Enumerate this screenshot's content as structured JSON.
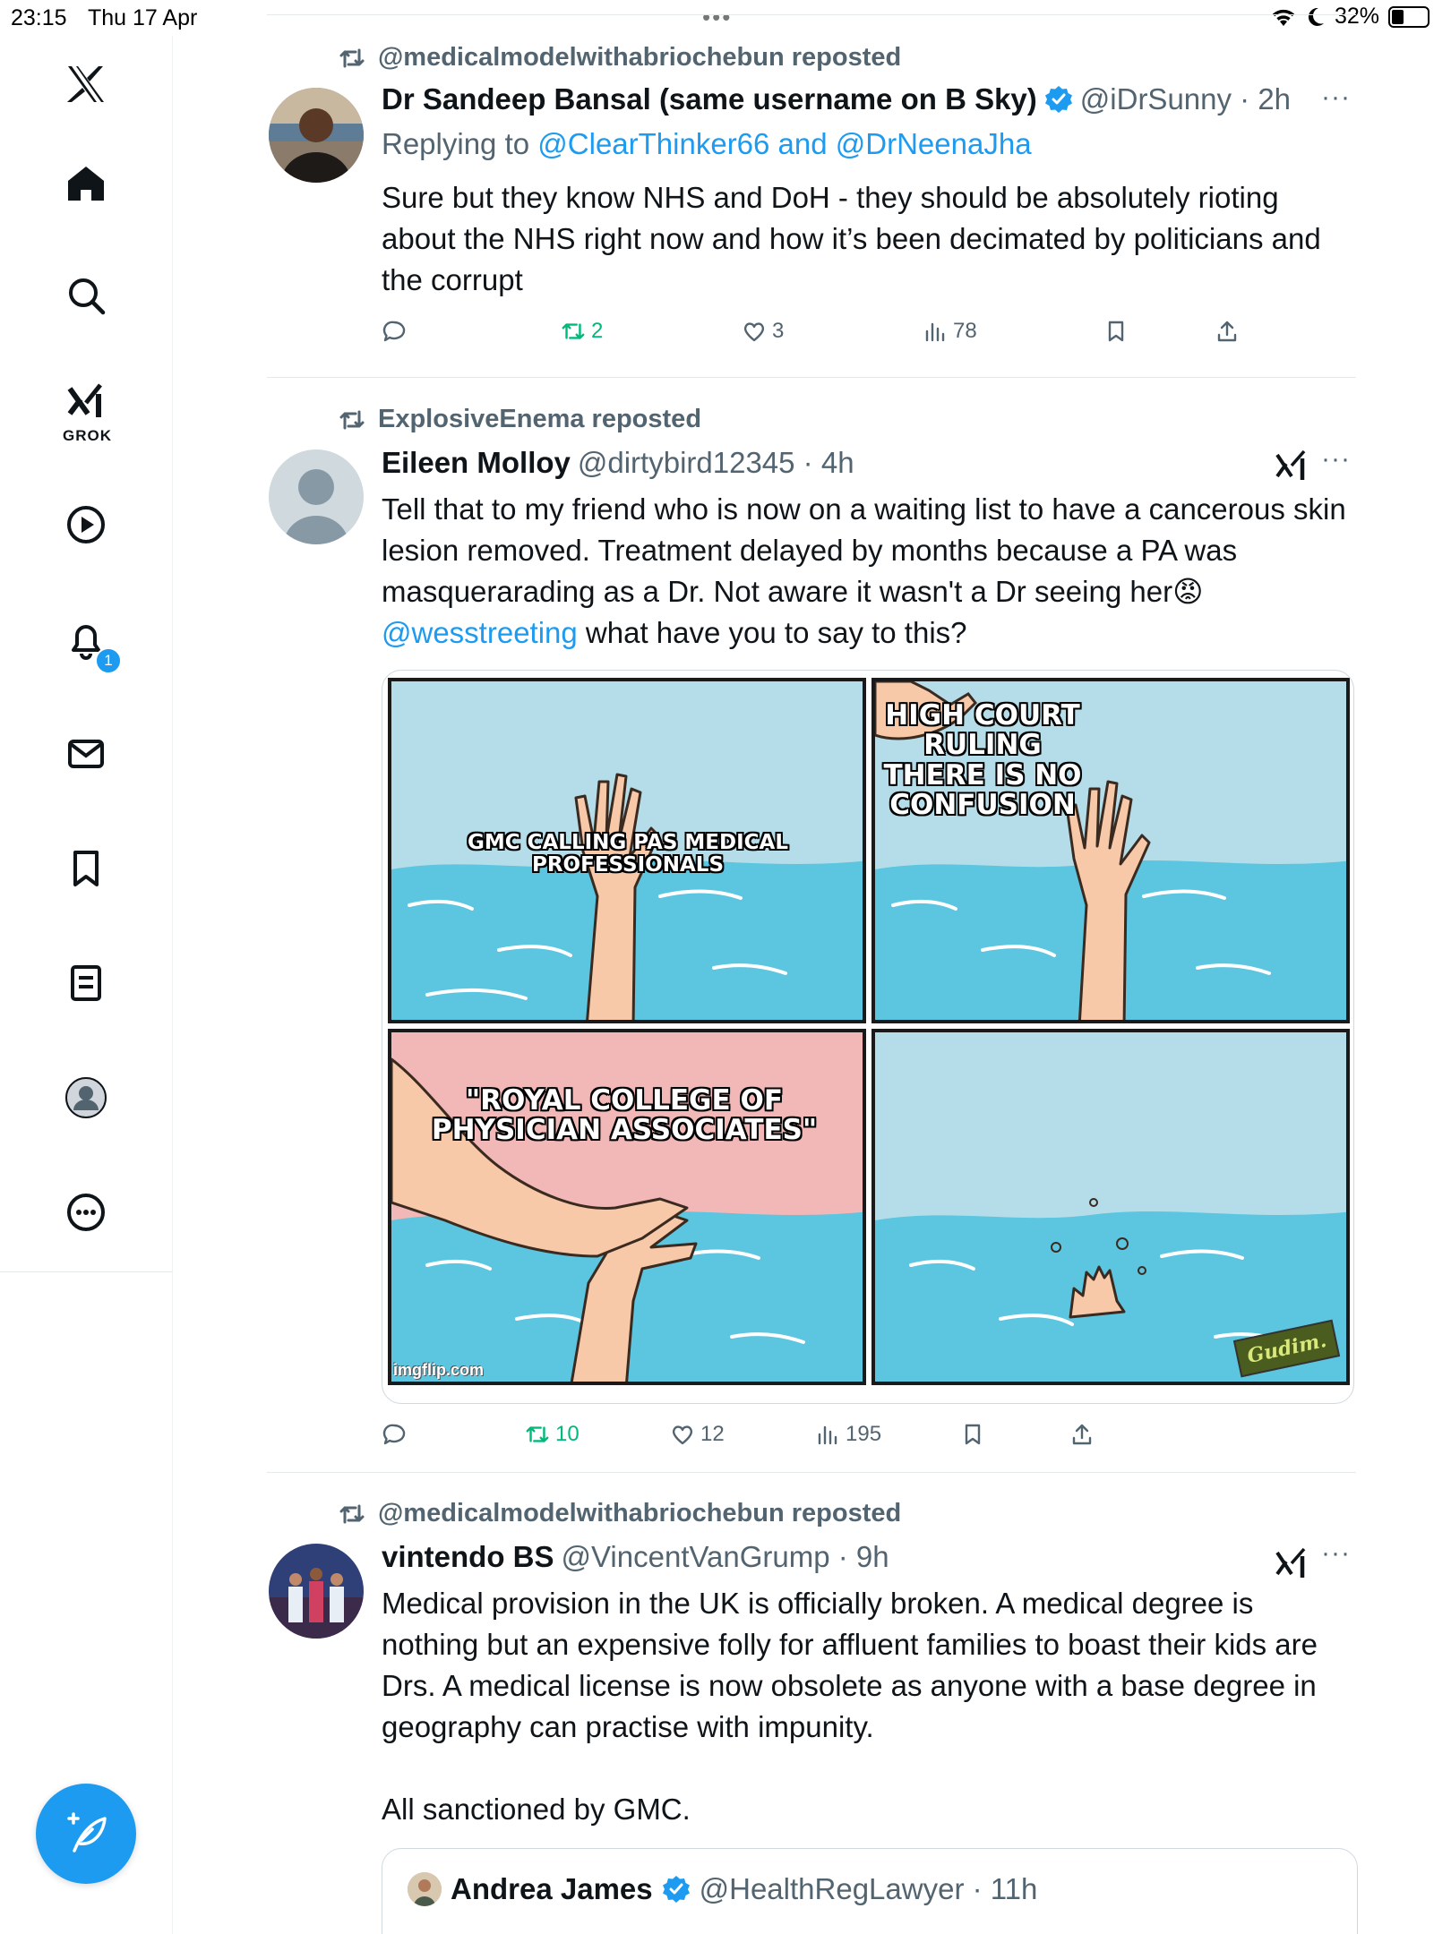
{
  "status_bar": {
    "time": "23:15",
    "date": "Thu 17 Apr",
    "battery": "32%"
  },
  "sidebar": {
    "grok_label": "GROK",
    "notification_count": "1"
  },
  "posts": [
    {
      "repost_by": "@medicalmodelwithabriochebun reposted",
      "author_name": "Dr Sandeep Bansal (same username on B Sky)",
      "handle_time": "@iDrSunny · 2h",
      "replying_to_prefix": "Replying to",
      "replying_to_mentions": "@ClearThinker66 and @DrNeenaJha",
      "text": "Sure but they know NHS and DoH - they should be absolutely rioting about the NHS right now and how it’s been decimated by politicians and the corrupt",
      "reposts": "2",
      "likes": "3",
      "views": "78"
    },
    {
      "repost_by": "ExplosiveEnema reposted",
      "author_name": "Eileen Molloy",
      "handle_time": "@dirtybird12345 · 4h",
      "text_main": "Tell that to my friend who is now on a waiting list to have a cancerous skin lesion removed. Treatment delayed by months because a PA was masquerarading as a Dr. Not aware it wasn't a Dr seeing her",
      "emoji": "😡",
      "mention": "@wesstreeting",
      "text_after_mention": " what have you to say to this?",
      "meme": {
        "panel1_caption": "GMC calling PAs medical professionals",
        "panel2_caption": "HIGH COURT RULING THERE IS NO CONFUSION",
        "panel3_caption": "\"ROYAL COLLEGE OF PHYSICIAN ASSOCIATES\"",
        "watermark": "imgflip.com",
        "artist_tag": "Gudim."
      },
      "reposts": "10",
      "likes": "12",
      "views": "195"
    },
    {
      "repost_by": "@medicalmodelwithabriochebun reposted",
      "author_name": "vintendo BS",
      "handle_time": "@VincentVanGrump · 9h",
      "text": "Medical provision in the UK is officially broken. A medical degree is nothing but an expensive folly for affluent families to boast their kids are Drs. A medical license is now obsolete as anyone with a base degree in geography can practise with impunity.",
      "text_2": "All sanctioned by GMC.",
      "quote": {
        "author_name": "Andrea James",
        "handle_time": "@HealthRegLawyer · 11h"
      }
    }
  ],
  "colors": {
    "accent": "#1d9bf0",
    "secondary_text": "#536471",
    "repost_green": "#00ba7c",
    "sea": "#5cc5e0",
    "sky": "#b5dde9",
    "pink": "#f2b8b8"
  }
}
